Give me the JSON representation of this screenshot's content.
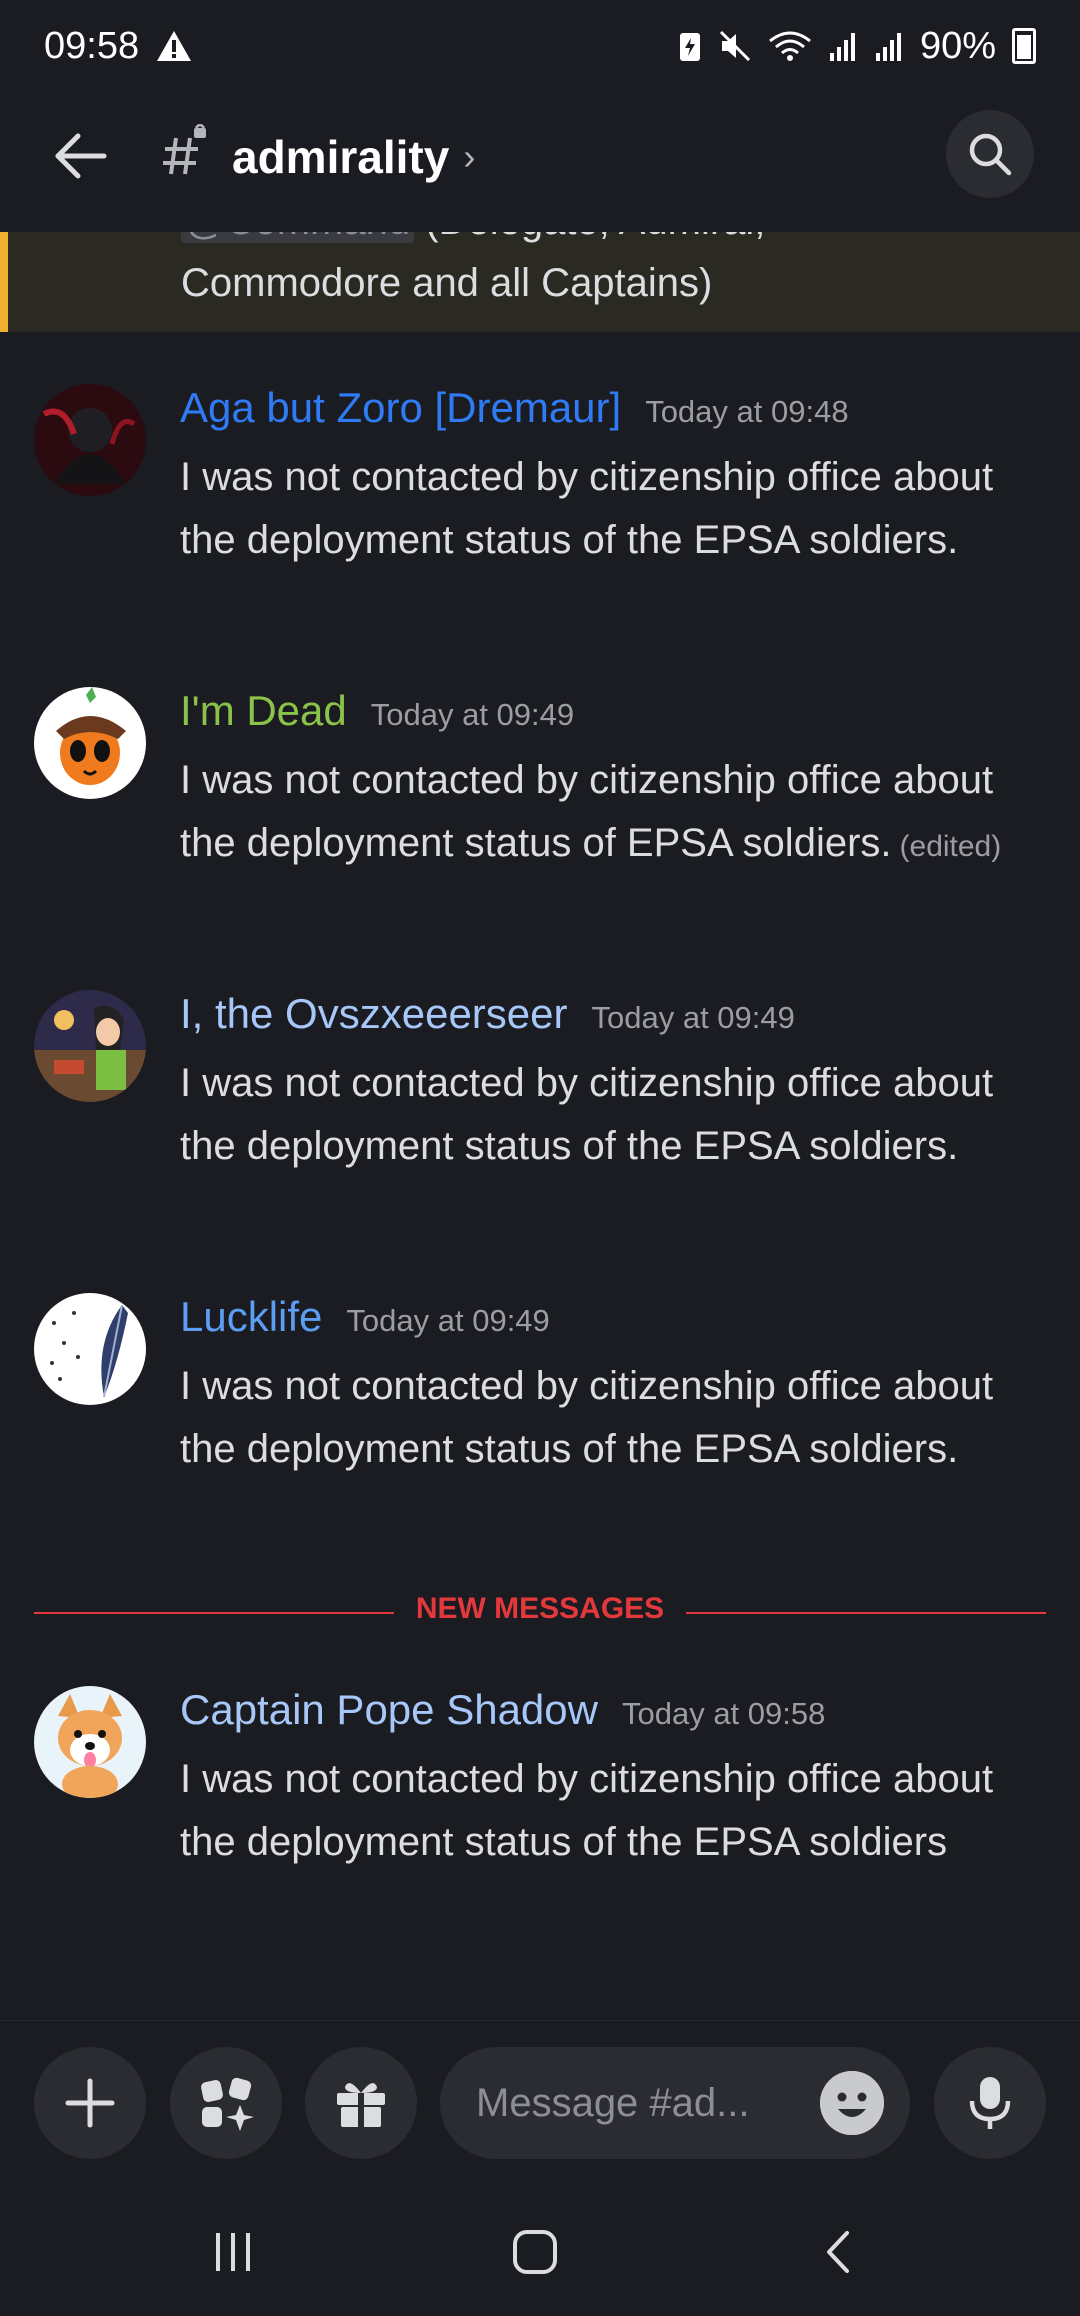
{
  "status_bar": {
    "time": "09:58",
    "battery": "90%",
    "icons": [
      "warning-icon",
      "battery-saver-icon",
      "mute-icon",
      "wifi-icon",
      "signal-icon",
      "signal-icon",
      "battery-icon"
    ]
  },
  "header": {
    "channel_name": "admirality",
    "chevron": "›"
  },
  "pinned_message": {
    "mention": "@Command",
    "text_line1": " (Delegate, Admiral,",
    "text_line2": "Commodore and all Captains)",
    "highlight_color": "#f0b132"
  },
  "messages": [
    {
      "author": "Aga but Zoro [Dremaur]",
      "author_color": "#2f7bf5",
      "timestamp": "Today at 09:48",
      "text": "I was not contacted by citizenship office about the deployment status of the EPSA soldiers.",
      "edited": ""
    },
    {
      "author": "I'm Dead",
      "author_color": "#8bc34a",
      "timestamp": "Today at 09:49",
      "text": "I was not contacted by citizenship office about the deployment status of EPSA soldiers.",
      "edited": "(edited)"
    },
    {
      "author": "I, the Ovszxeeerseer",
      "author_color": "#a7c7f9",
      "timestamp": "Today at 09:49",
      "text": "I was not contacted by citizenship office about the deployment status of the EPSA soldiers.",
      "edited": ""
    },
    {
      "author": "Lucklife",
      "author_color": "#5b9ef3",
      "timestamp": "Today at 09:49",
      "text": "I was not contacted by citizenship office about the deployment status of the EPSA soldiers.",
      "edited": ""
    },
    {
      "author": "Captain Pope Shadow",
      "author_color": "#a7c7f9",
      "timestamp": "Today at 09:58",
      "text": "I was not contacted by citizenship office about the deployment status of the EPSA soldiers",
      "edited": ""
    }
  ],
  "new_messages_divider": {
    "label": "NEW MESSAGES",
    "color": "#e3393c"
  },
  "composer": {
    "placeholder": "Message #ad...",
    "buttons": [
      "plus-icon",
      "apps-icon",
      "gift-icon",
      "emoji-icon",
      "microphone-icon"
    ]
  },
  "nav_bar": {
    "buttons": [
      "recents-icon",
      "home-icon",
      "back-icon"
    ]
  }
}
